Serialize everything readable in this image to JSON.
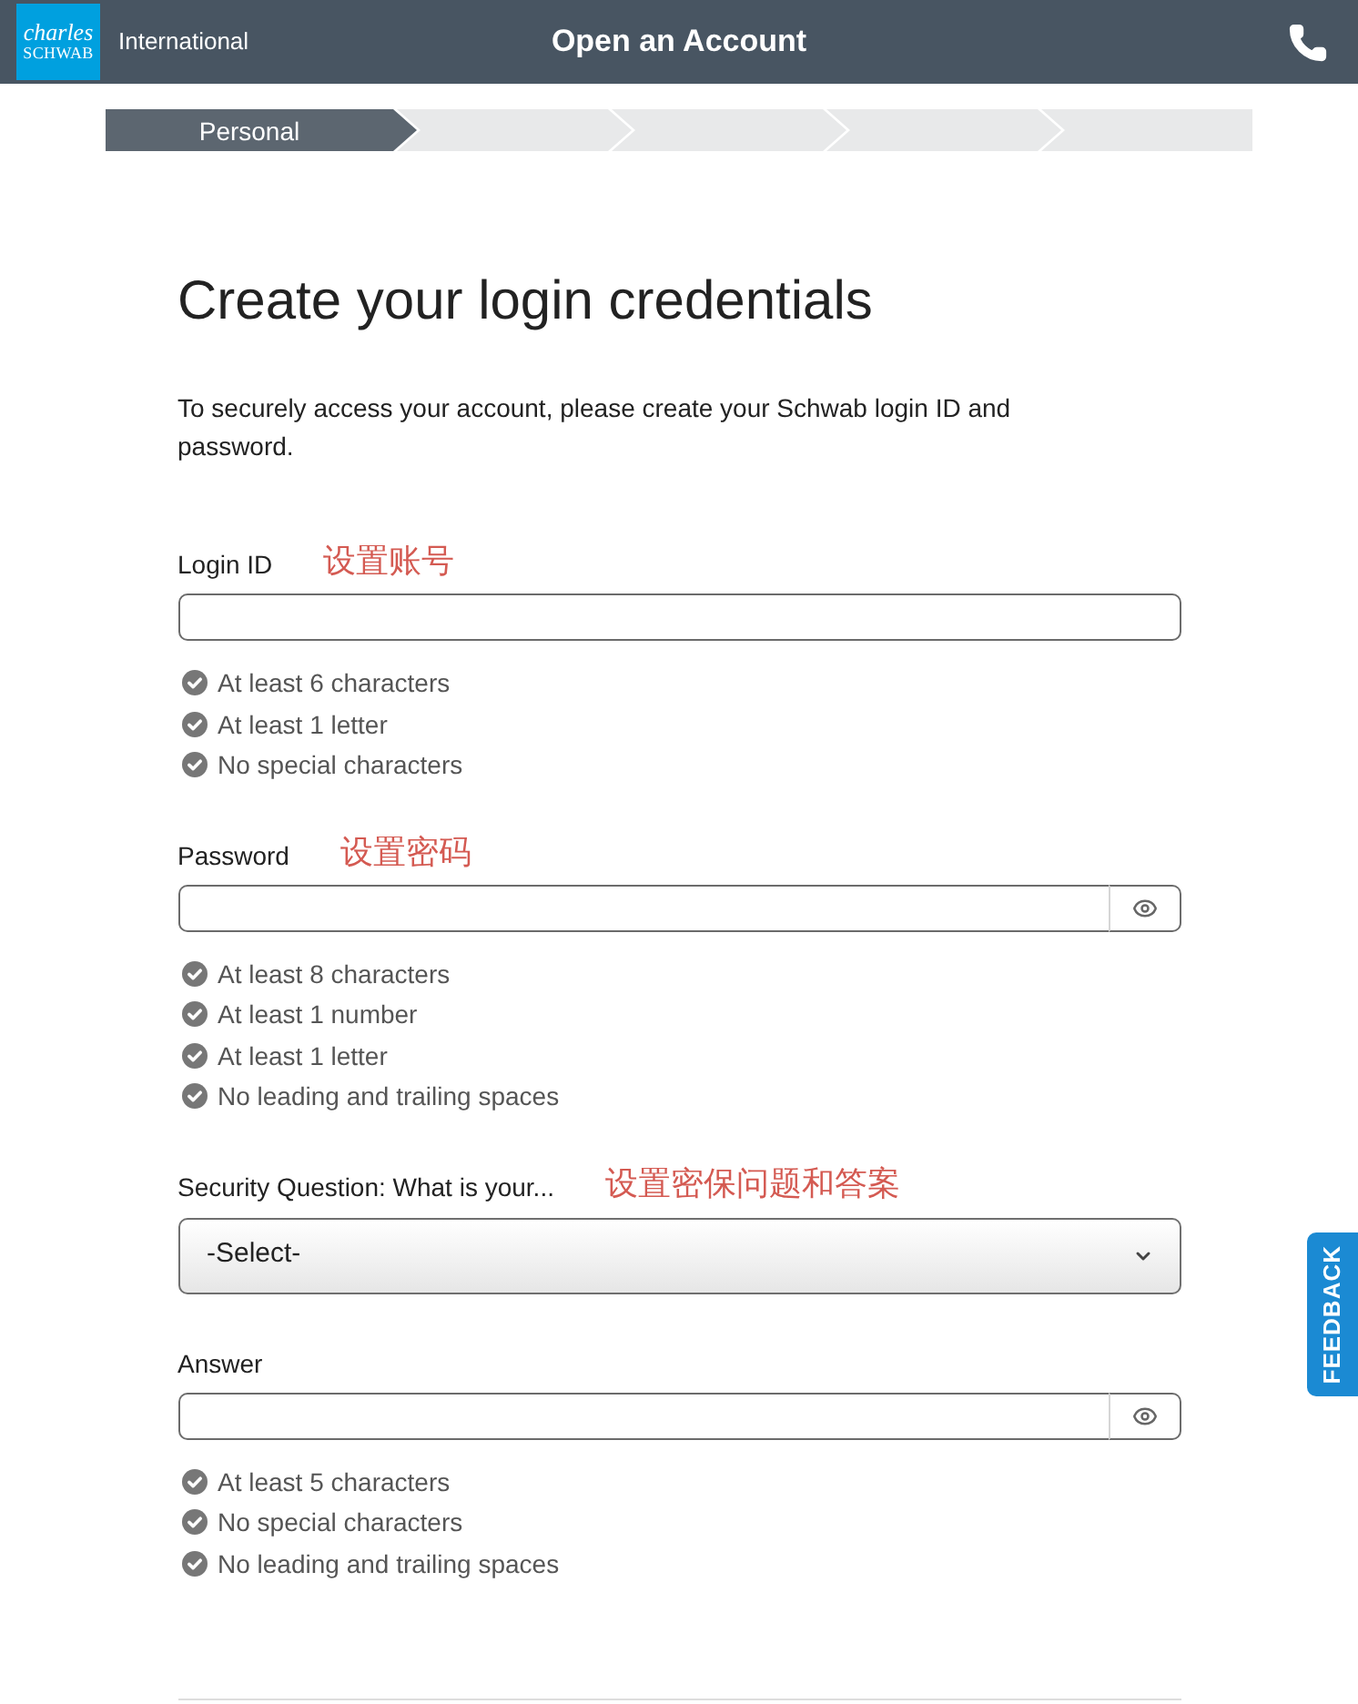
{
  "header": {
    "logo": [
      "charles",
      "SCHWAB"
    ],
    "region": "International",
    "title": "Open an Account"
  },
  "progress_steps": [
    {
      "label": "Personal",
      "selected": true
    },
    {
      "selected": false
    },
    {
      "selected": false
    },
    {
      "selected": false
    },
    {
      "selected": false
    }
  ],
  "heading": "Create your login credentials",
  "intro": "To securely access your account, please create your Schwab login ID and password.",
  "fields": [
    {
      "kind": "text",
      "label": "Login ID",
      "annotation": "设置账号",
      "rules": [
        {
          "text": "At least 6 characters",
          "met": false
        },
        {
          "text": "At least 1 letter",
          "met": false
        },
        {
          "text": "No special characters",
          "met": false
        }
      ]
    },
    {
      "kind": "password",
      "label": "Password",
      "annotation": "设置密码",
      "rules": [
        {
          "text": "At least 8 characters",
          "met": false
        },
        {
          "text": "At least 1 number",
          "met": false
        },
        {
          "text": "At least 1 letter",
          "met": false
        },
        {
          "text": "No leading and trailing spaces",
          "met": false
        }
      ]
    },
    {
      "kind": "select",
      "label": "Security Question: What is your...",
      "annotation": "设置密保问题和答案",
      "value": "-Select-"
    },
    {
      "kind": "password",
      "label": "Answer",
      "rules": [
        {
          "text": "At least 5 characters",
          "met": false
        },
        {
          "text": "No special characters",
          "met": false
        },
        {
          "text": "No leading and trailing spaces",
          "met": false
        }
      ]
    }
  ],
  "feedback_tab": {
    "label": "FEEDBACK"
  }
}
